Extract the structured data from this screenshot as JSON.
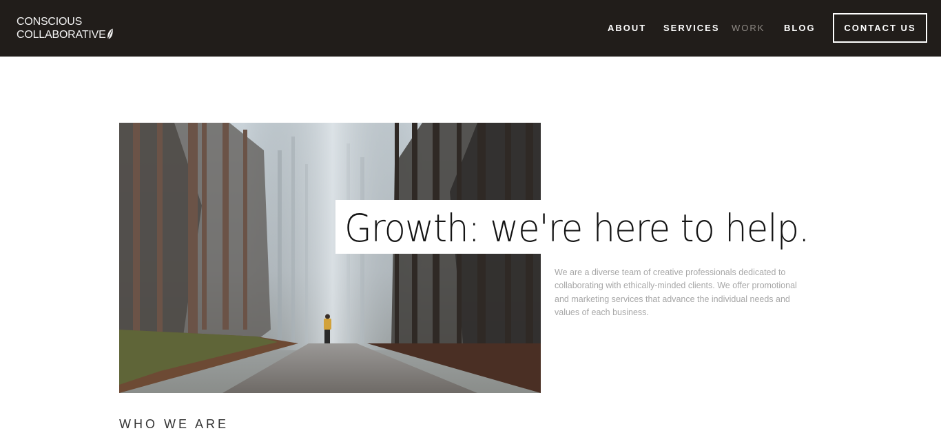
{
  "header": {
    "logo": {
      "line1": "CONSCIOUS",
      "line2": "COLLABORATIVE",
      "icon": "leaf-icon"
    },
    "nav": {
      "about": "ABOUT",
      "services": "SERVICES",
      "work": "WORK",
      "blog": "BLOG"
    },
    "active_item": "work",
    "contact_label": "CONTACT US"
  },
  "hero": {
    "image_subject": "forest-path-hiker",
    "headline": "Growth: we're here to help.",
    "intro": "We are a diverse team of creative professionals dedicated to collaborating with ethically-minded clients. We offer promotional and marketing services that advance the individual needs and values of each business."
  },
  "sections": {
    "who_we_are": "WHO WE ARE"
  },
  "colors": {
    "header_bg": "#211d1a",
    "nav_text": "#ffffff",
    "nav_active": "#8f8a85",
    "intro_text": "#a7a7a7",
    "headline_text": "#141414"
  }
}
